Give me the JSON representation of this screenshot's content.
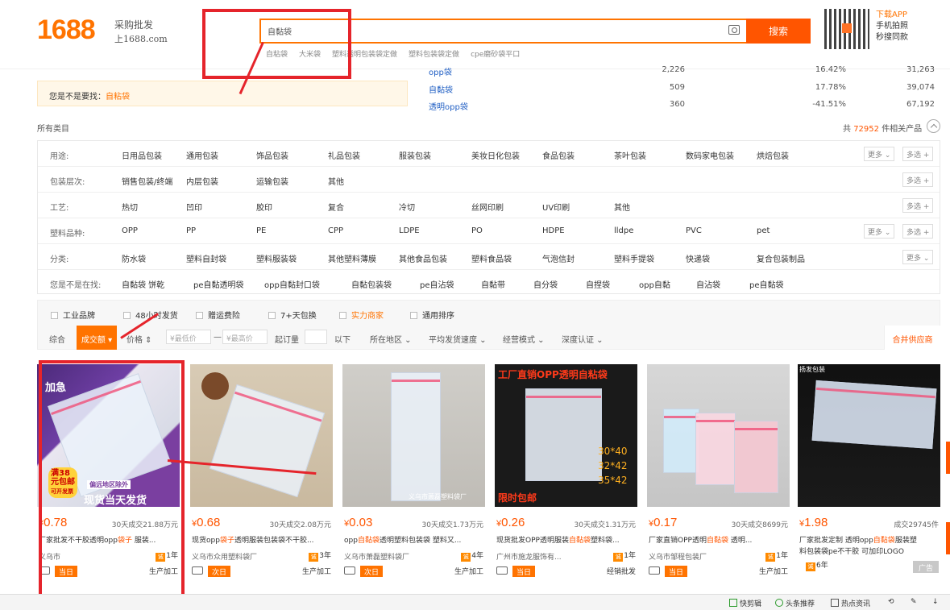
{
  "header": {
    "logo_number": "1688",
    "logo_cn": "采购批发",
    "logo_url": "上1688.com",
    "search_value": "自黏袋",
    "search_button": "搜索",
    "hot_words": [
      "自粘袋",
      "大米袋",
      "塑料透明包装袋定做",
      "塑料包装袋定做",
      "cpe磨砂袋平口"
    ],
    "app_lines": [
      "下载APP",
      "手机拍照",
      "秒搜同款"
    ]
  },
  "suggest": [
    {
      "keyword": "opp袋",
      "v1": "2,226",
      "v2": "16.42%",
      "v3": "31,263"
    },
    {
      "keyword": "自黏袋",
      "v1": "509",
      "v2": "17.78%",
      "v3": "39,074"
    },
    {
      "keyword": "透明opp袋",
      "v1": "360",
      "v2": "-41.51%",
      "v3": "67,192"
    }
  ],
  "want": {
    "prefix": "您是不是要找：",
    "keyword": "自粘袋"
  },
  "categories": {
    "label": "所有类目",
    "total_prefix": "共",
    "total_num": "72952",
    "total_suffix": "件相关产品"
  },
  "filters": [
    {
      "label": "用途:",
      "items": [
        "日用品包装",
        "通用包装",
        "饰品包装",
        "礼品包装",
        "服装包装",
        "美妆日化包装",
        "食品包装",
        "茶叶包装",
        "数码家电包装",
        "烘焙包装"
      ],
      "more": "更多",
      "multi": "多选"
    },
    {
      "label": "包装层次:",
      "items": [
        "销售包装/终端",
        "内层包装",
        "运输包装",
        "其他"
      ],
      "more": "",
      "multi": "多选"
    },
    {
      "label": "工艺:",
      "items": [
        "热切",
        "凹印",
        "胶印",
        "复合",
        "冷切",
        "丝网印刷",
        "UV印刷",
        "其他"
      ],
      "more": "",
      "multi": "多选"
    },
    {
      "label": "塑料品种:",
      "items": [
        "OPP",
        "PP",
        "PE",
        "CPP",
        "LDPE",
        "PO",
        "HDPE",
        "lldpe",
        "PVC",
        "pet"
      ],
      "more": "更多",
      "multi": "多选"
    },
    {
      "label": "分类:",
      "items": [
        "防水袋",
        "塑料自封袋",
        "塑料服装袋",
        "其他塑料薄膜",
        "其他食品包装",
        "塑料食品袋",
        "气泡信封",
        "塑料手提袋",
        "快递袋",
        "复合包装制品"
      ],
      "more": "更多",
      "multi": ""
    },
    {
      "label": "您是不是在找:",
      "items": [
        "自黏袋 饼乾",
        "pe自黏透明袋",
        "opp自黏封口袋",
        "自黏包装袋",
        "pe自沾袋",
        "自黏带",
        "自分袋",
        "自捏袋",
        "opp自黏",
        "自沾袋",
        "pe自黏袋"
      ],
      "more": "",
      "multi": ""
    }
  ],
  "checks": [
    {
      "label": "工业品牌",
      "orange": false
    },
    {
      "label": "48小时发货",
      "orange": false
    },
    {
      "label": "赠运费险",
      "orange": false
    },
    {
      "label": "7+天包换",
      "orange": false
    },
    {
      "label": "实力商家",
      "orange": true
    },
    {
      "label": "通用排序",
      "orange": false
    }
  ],
  "sort": {
    "comprehensive": "综合",
    "active": "成交额",
    "price": "价格",
    "min_price": "¥最低价",
    "max_price": "¥最高价",
    "dash": "—",
    "moq_label": "起订量",
    "below": "以下",
    "region": "所在地区",
    "speed": "平均发货速度",
    "mode": "经营模式",
    "depth": "深度认证",
    "merge": "合并供应商"
  },
  "products": [
    {
      "price": "0.78",
      "sold": "30天成交21.88万元",
      "title_a": "厂家批发不干胶透明opp",
      "title_hl": "袋子",
      "title_b": " 服装...",
      "seller": "义乌市",
      "years": "1年",
      "tag": "当日",
      "mode": "生产加工",
      "overlay": [
        "加急",
        "满38",
        "元包邮",
        "可开发票",
        "偏远地区除外",
        "现货当天发货"
      ]
    },
    {
      "price": "0.68",
      "sold": "30天成交2.08万元",
      "title_a": "现货opp",
      "title_hl": "袋子",
      "title_b": "透明服装包装袋不干胶...",
      "seller": "义乌市众用塑料袋厂",
      "years": "3年",
      "tag": "次日",
      "mode": "生产加工",
      "overlay": []
    },
    {
      "price": "0.03",
      "sold": "30天成交1.73万元",
      "title_a": "opp",
      "title_hl": "自黏袋",
      "title_b": "透明塑料包装袋 塑料又...",
      "seller": "义乌市萧磊塑料袋厂",
      "years": "4年",
      "tag": "次日",
      "mode": "生产加工",
      "overlay": [
        "义乌市萧磊塑料袋厂"
      ]
    },
    {
      "price": "0.26",
      "sold": "30天成交1.31万元",
      "title_a": "现货批发OPP透明服装",
      "title_hl": "自黏袋",
      "title_b": "塑料袋...",
      "seller": "广州市施龙服饰有...",
      "years": "1年",
      "tag": "当日",
      "mode": "经销批发",
      "overlay": [
        "工厂直销OPP透明自粘袋",
        "30*40",
        "32*42",
        "35*42",
        "限时包邮"
      ]
    },
    {
      "price": "0.17",
      "sold": "30天成交8699元",
      "title_a": "厂家直销OPP透明",
      "title_hl": "自黏袋",
      "title_b": " 透明...",
      "seller": "义乌市邹程包装厂",
      "years": "1年",
      "tag": "当日",
      "mode": "生产加工",
      "overlay": []
    },
    {
      "price": "1.98",
      "sold": "成交29745件",
      "title_a": "厂家批发定制 透明opp",
      "title_hl": "自黏袋",
      "title_b": "服装塑",
      "title_line2": "料包装袋pe不干胶 可加印LOGO",
      "seller": "",
      "years": "6年",
      "tag": "",
      "mode": "",
      "ad": "广告",
      "overlay": [
        "扬发包装"
      ]
    }
  ],
  "bottom_bar": [
    "快剪辑",
    "头条推荐",
    "热点资讯"
  ],
  "colors": {
    "accent": "#ff7300",
    "search_btn": "#ff5500",
    "link": "#2260c4",
    "annotation": "#e5242b"
  }
}
